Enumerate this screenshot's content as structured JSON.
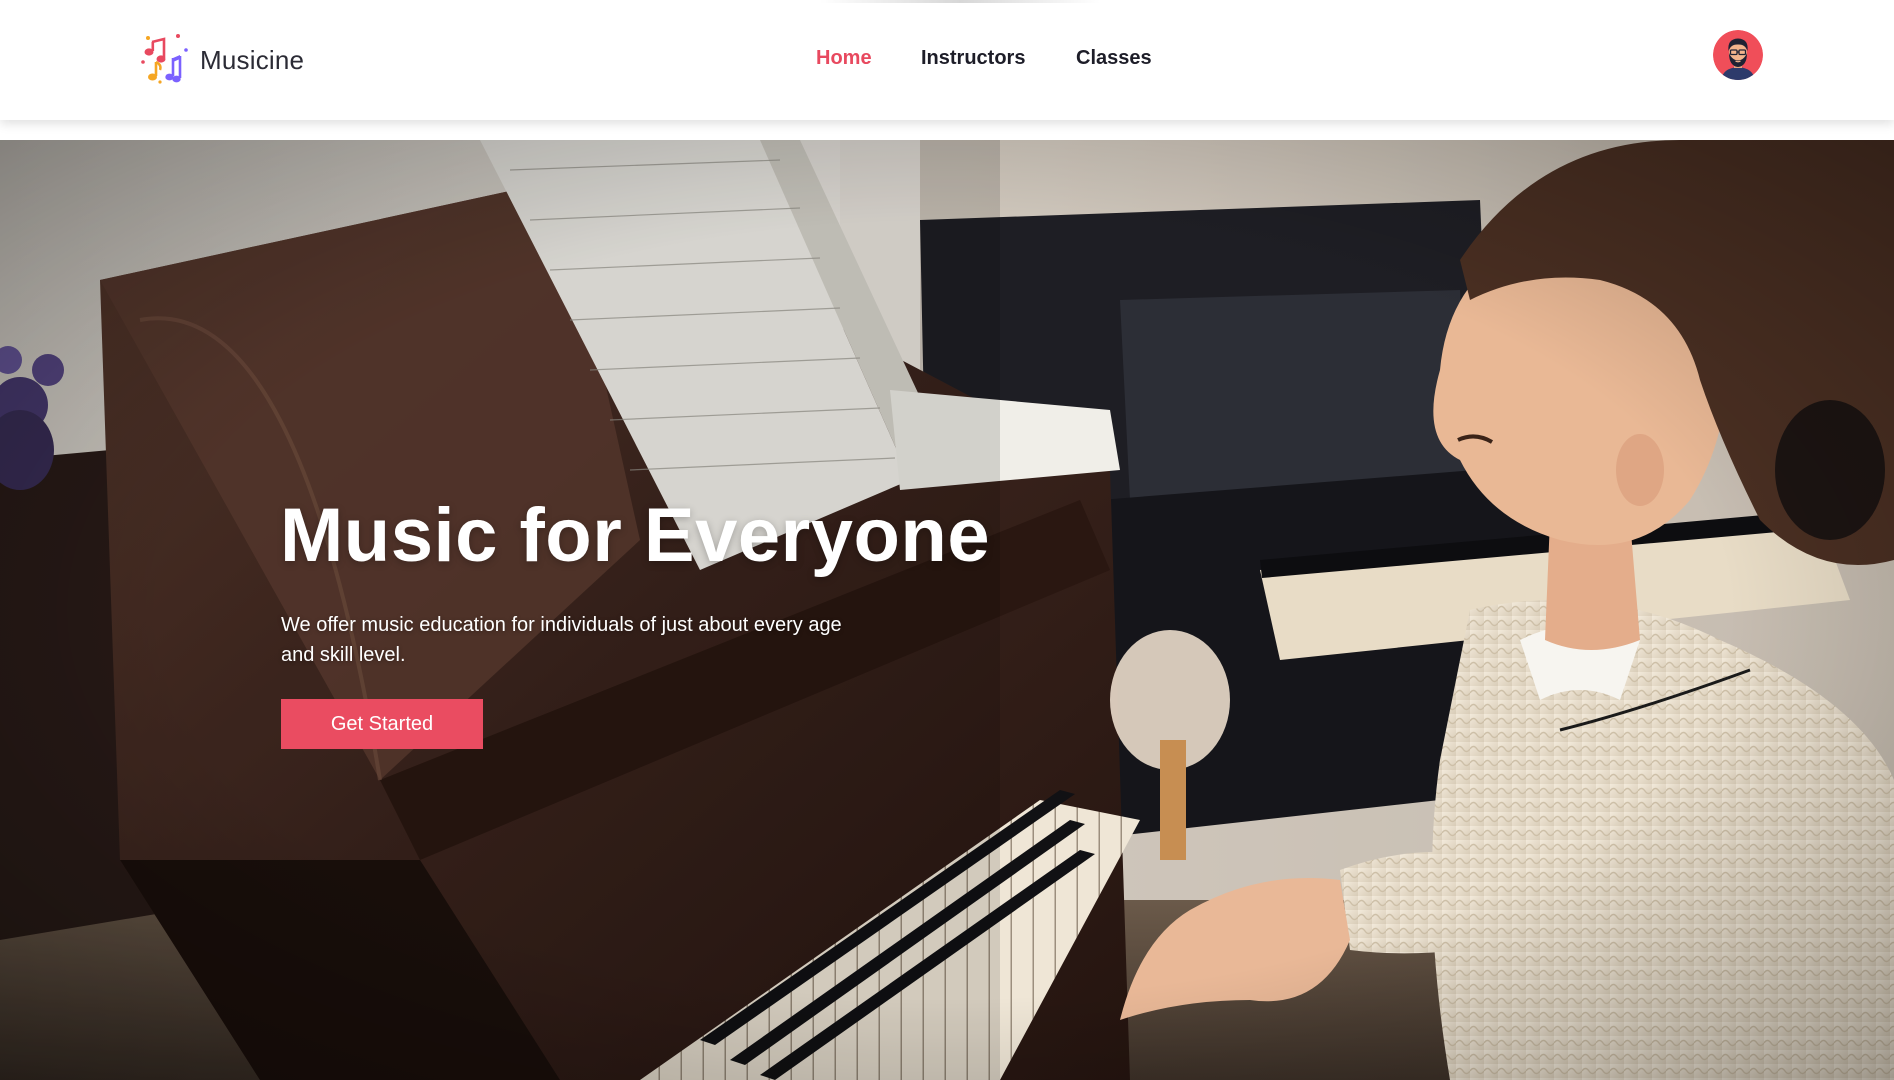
{
  "brand": {
    "name": "Musicine",
    "logo_icon": "music-notes-icon"
  },
  "nav": {
    "items": [
      {
        "label": "Home",
        "active": true
      },
      {
        "label": "Instructors",
        "active": false
      },
      {
        "label": "Classes",
        "active": false
      }
    ],
    "active_color": "#e8495f"
  },
  "user": {
    "avatar_icon": "bearded-man-avatar-icon"
  },
  "hero": {
    "title": "Music for Everyone",
    "subtitle": "We offer music education for individuals of just about every age and skill level.",
    "cta_label": "Get Started",
    "background_image": "girl-playing-piano-photo"
  },
  "colors": {
    "accent": "#ea4c61",
    "text_dark": "#1d1d28",
    "header_bg": "#ffffff"
  }
}
